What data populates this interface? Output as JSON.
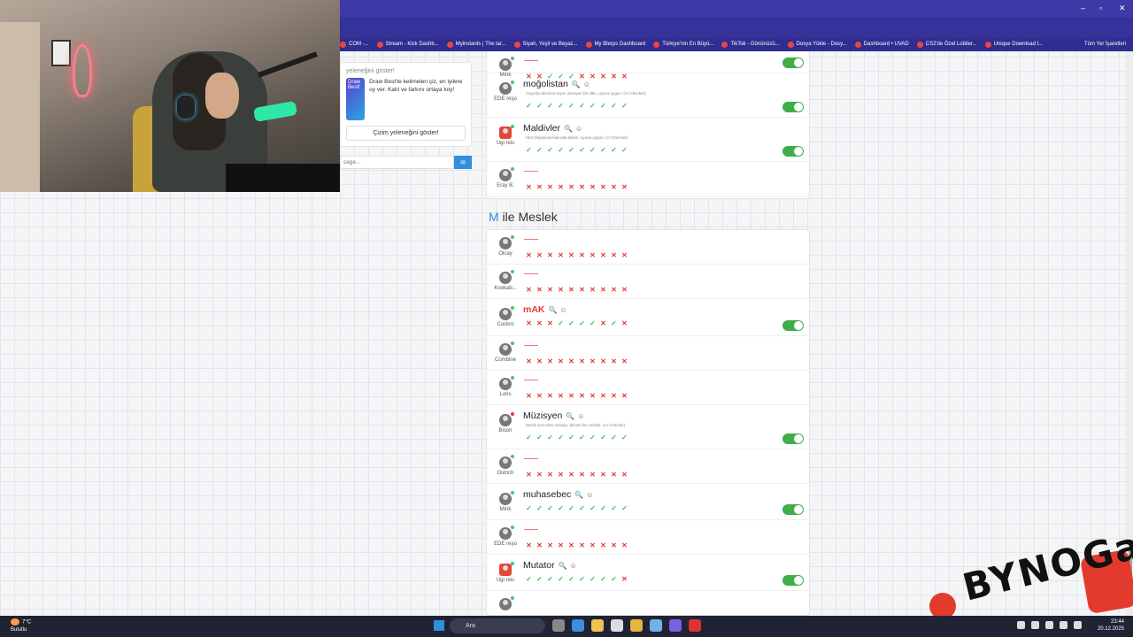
{
  "browser": {
    "bookmarks": [
      "COM -...",
      "Stream - Kick Dashb...",
      "Myinstants | The lar...",
      "Siyah, Yeşil ve Beyaz...",
      "My Blerps Dashboard",
      "Türkiye'nin En Büyü...",
      "TikTok - Gönünüzü...",
      "Dosya Yükle - Dosy...",
      "Dashboard • UVAD",
      "CS2'de Özel Lobiler...",
      "Unique Download I..."
    ],
    "all_bookmarks": "Tüm Yer İşaretleri"
  },
  "left_panel": {
    "heading": "yeleneğini göster!",
    "promo_title": "Draw Best!",
    "promo_text": "Draw Best'te kelimelen çiz, en iyilere oy ver. Katıl ve farkını ortaya koy!",
    "show_button": "Çizim yeleneğini göster!",
    "chat_placeholder": "sage..."
  },
  "accent_colors": {
    "correct": "#45b650",
    "wrong": "#e03c3c",
    "toggle": "#3fae49",
    "link": "#2f8fe0"
  },
  "group1": [
    {
      "player": "Mink",
      "word": "",
      "marks": "xxoooxxxxx",
      "toggle": true
    },
    {
      "player": "EDE reşo",
      "word": "moğolistan",
      "hint": "Asya'da denizine kıyısı olmayan bir ülke, oyuna uygun. (AI Checker)",
      "marks": "oooooooooo",
      "toggle": true
    },
    {
      "player": "Ugi reis",
      "word": "Maldivler",
      "hint": "Hint Okyanusu'nda ada ülkesi; oyuna uygun. (AI Checker)",
      "marks": "oooooooooo",
      "toggle": true
    },
    {
      "player": "Eray B.",
      "word": "",
      "marks": "xxxxxxxxxx",
      "toggle": false
    }
  ],
  "section": {
    "first_letter": "M",
    "title_rest": " ile Meslek"
  },
  "group2": [
    {
      "player": "Olcay",
      "word": "",
      "marks": "xxxxxxxxxx",
      "toggle": false
    },
    {
      "player": "Kookab...",
      "word": "",
      "marks": "xxxxxxxxxx",
      "toggle": false
    },
    {
      "player": "Cockro",
      "word": "mAK",
      "red": true,
      "marks": "xxxooooxox",
      "toggle": true
    },
    {
      "player": "Combine",
      "word": "",
      "marks": "xxxxxxxxxx",
      "toggle": false
    },
    {
      "player": "Loris",
      "word": "",
      "marks": "xxxxxxxxxx",
      "toggle": false
    },
    {
      "player": "Bison",
      "word": "Müzisyen",
      "hint": "Müzik icra eden sanatçı; bilinen bir meslek. (AI Checker)",
      "marks": "oooooooooo",
      "toggle": true
    },
    {
      "player": "Ostrich",
      "word": "",
      "marks": "xxxxxxxxxx",
      "toggle": false
    },
    {
      "player": "Mink",
      "word": "muhasebec",
      "marks": "oooooooooo",
      "toggle": true
    },
    {
      "player": "EDE reşo",
      "word": "",
      "marks": "xxxxxxxxxx",
      "toggle": false
    },
    {
      "player": "Ugi reis",
      "word": "Mutator",
      "marks": "ooooooooox",
      "toggle": true
    },
    {
      "player": "",
      "word": "",
      "marks": "",
      "toggle": false
    }
  ],
  "watermark": {
    "text": "BYNOGam"
  },
  "taskbar": {
    "temperature": "7°C",
    "weather": "Bulutlu",
    "search_label": "Ara",
    "time": "23:44",
    "date": "20.12.2025"
  }
}
